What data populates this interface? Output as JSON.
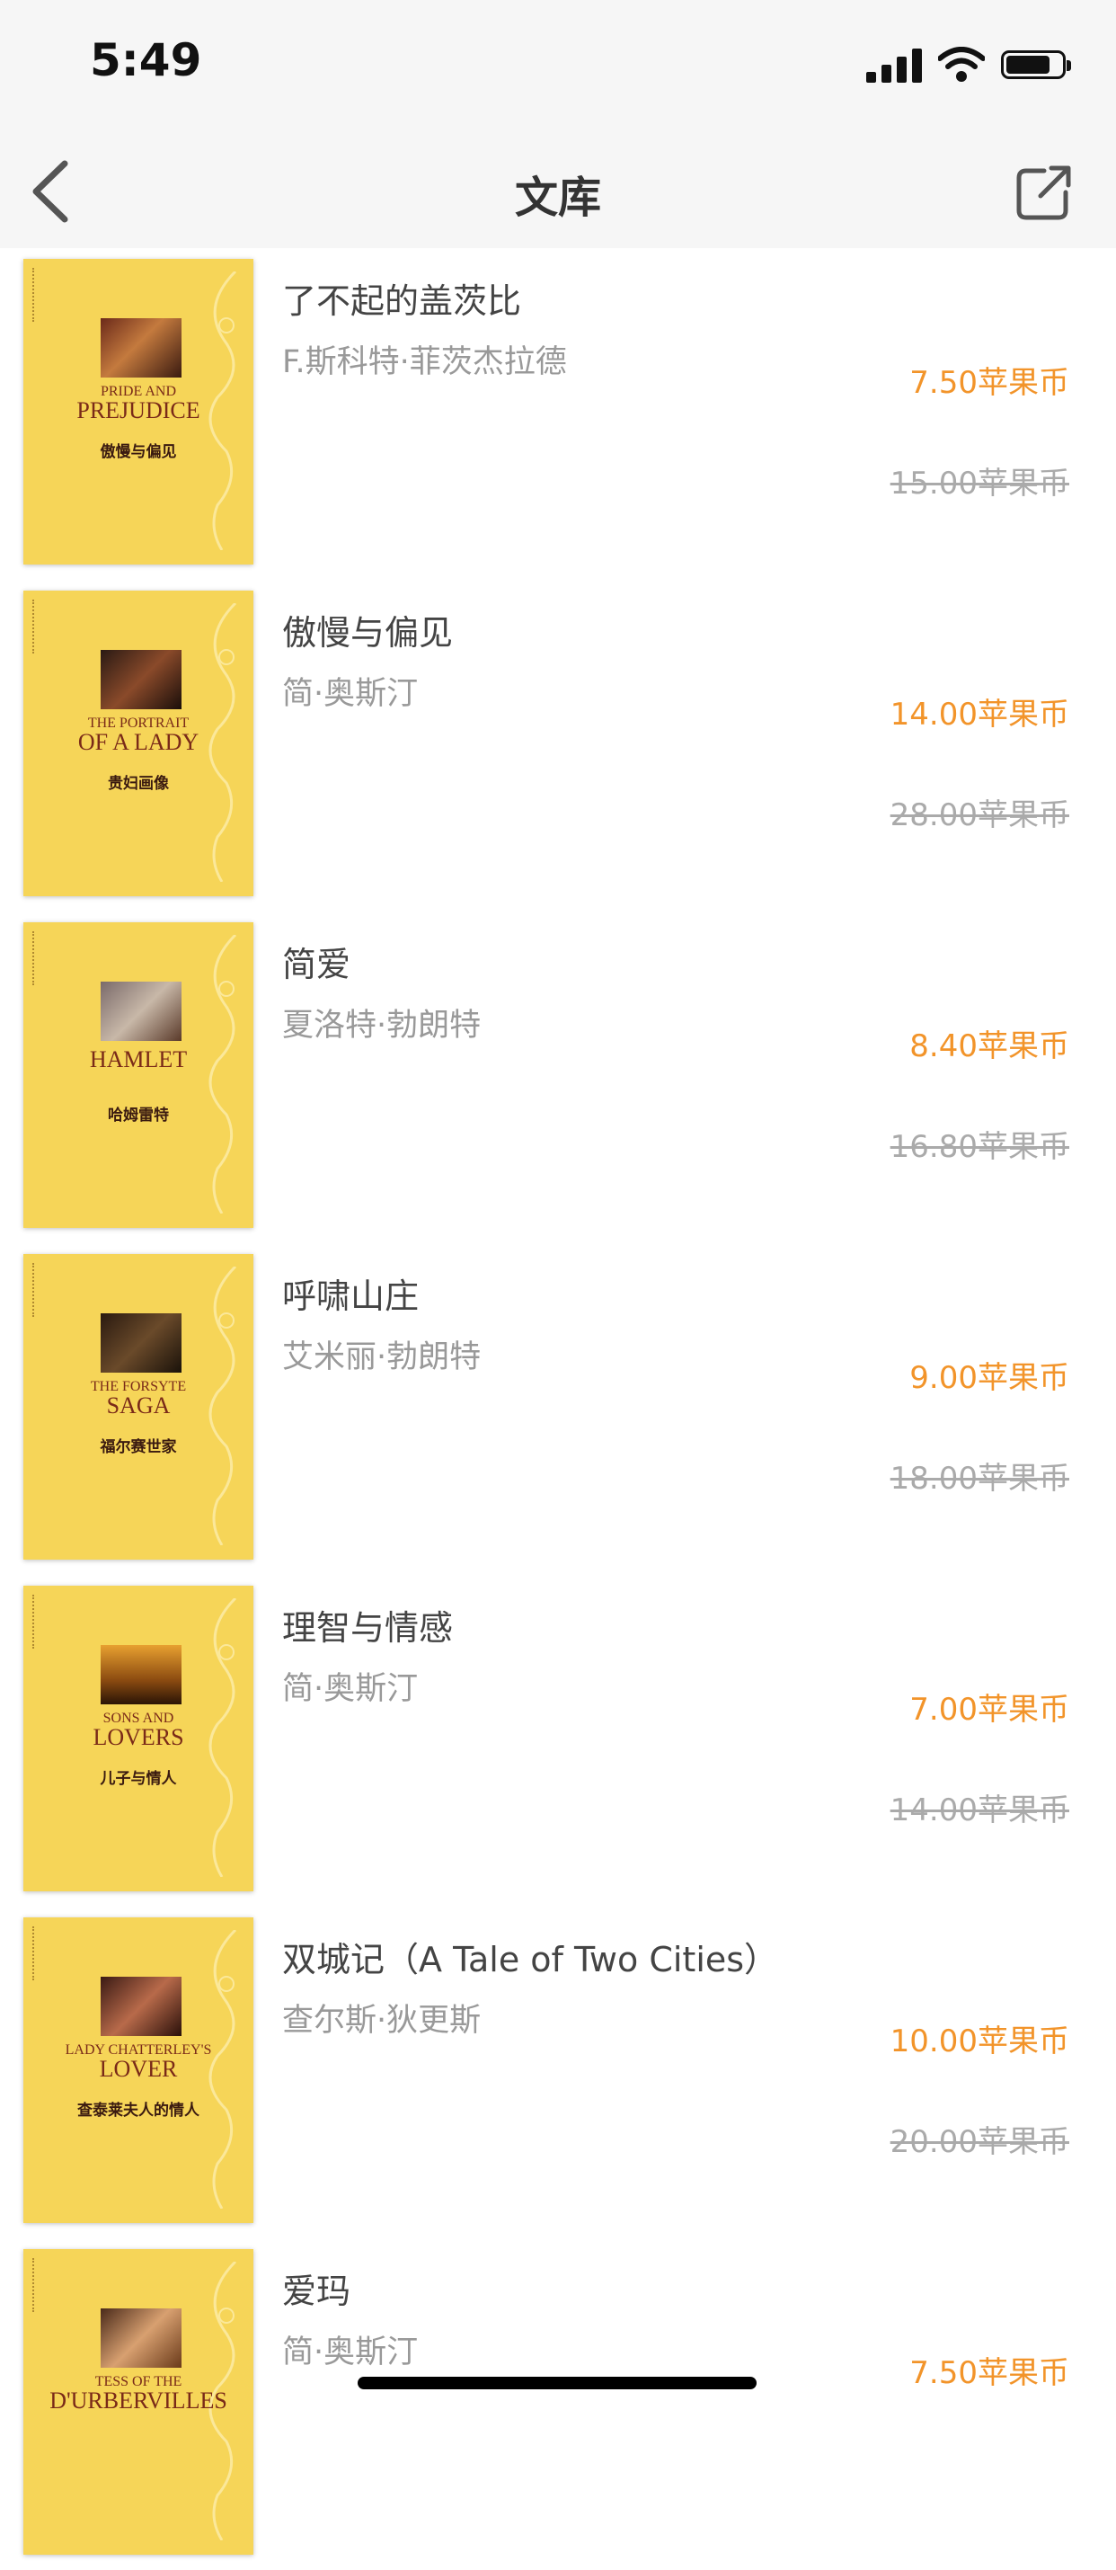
{
  "status_bar": {
    "time": "5:49"
  },
  "nav": {
    "title": "文库"
  },
  "books": [
    {
      "title": "了不起的盖茨比",
      "author": "F.斯科特·菲茨杰拉德",
      "price": "7.50苹果币",
      "original_price": "15.00苹果币",
      "cover": {
        "title_line1": "PRIDE AND",
        "title_line2": "PREJUDICE",
        "title_cn": "傲慢与偏见"
      }
    },
    {
      "title": "傲慢与偏见",
      "author": "简·奥斯汀",
      "price": "14.00苹果币",
      "original_price": "28.00苹果币",
      "cover": {
        "title_line1": "THE PORTRAIT",
        "title_line2": "OF A LADY",
        "title_cn": "贵妇画像"
      }
    },
    {
      "title": "简爱",
      "author": "夏洛特·勃朗特",
      "price": "8.40苹果币",
      "original_price": "16.80苹果币",
      "cover": {
        "title_line1": "",
        "title_line2": "HAMLET",
        "title_cn": "哈姆雷特"
      }
    },
    {
      "title": "呼啸山庄",
      "author": "艾米丽·勃朗特",
      "price": "9.00苹果币",
      "original_price": "18.00苹果币",
      "cover": {
        "title_line1": "THE FORSYTE",
        "title_line2": "SAGA",
        "title_cn": "福尔赛世家"
      }
    },
    {
      "title": "理智与情感",
      "author": "简·奥斯汀",
      "price": "7.00苹果币",
      "original_price": "14.00苹果币",
      "cover": {
        "title_line1": "SONS AND",
        "title_line2": "LOVERS",
        "title_cn": "儿子与情人"
      }
    },
    {
      "title": "双城记（A Tale of Two Cities）",
      "author": "查尔斯·狄更斯",
      "price": "10.00苹果币",
      "original_price": "20.00苹果币",
      "cover": {
        "title_line1": "LADY CHATTERLEY'S",
        "title_line2": "LOVER",
        "title_cn": "查泰莱夫人的情人"
      }
    },
    {
      "title": "爱玛",
      "author": "简·奥斯汀",
      "price": "7.50苹果币",
      "original_price": "",
      "cover": {
        "title_line1": "TESS OF THE",
        "title_line2": "D'URBERVILLES",
        "title_cn": ""
      }
    }
  ]
}
